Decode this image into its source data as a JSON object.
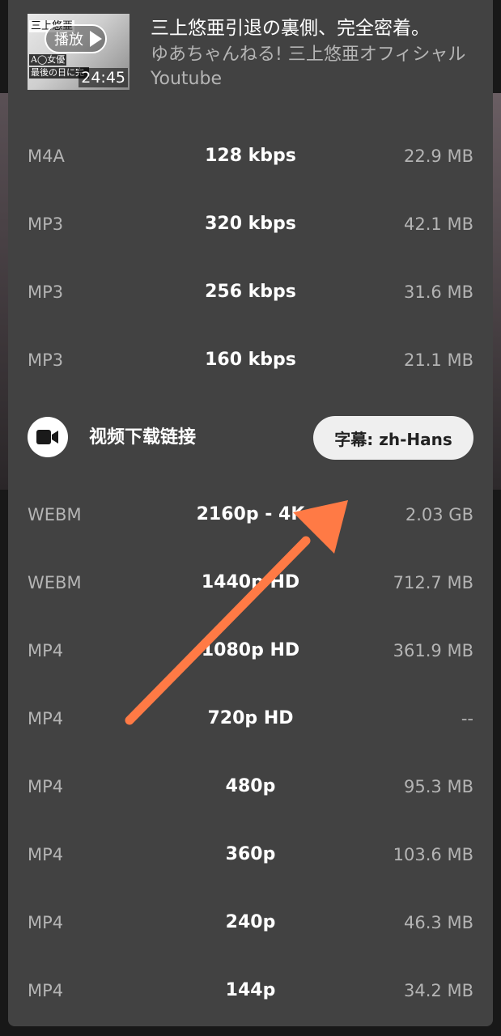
{
  "video": {
    "title": "三上悠亜引退の裏側、完全密着。",
    "channel": "ゆあちゃんねる! 三上悠亜オフィシャルYoutube",
    "duration": "24:45",
    "play_label": "播放",
    "thumb_text_1": "三上悠亜",
    "thumb_text_2": "A◯女優",
    "thumb_text_3": "最後の日に完"
  },
  "audio_options": [
    {
      "format": "M4A",
      "quality": "128 kbps",
      "size": "22.9 MB"
    },
    {
      "format": "MP3",
      "quality": "320 kbps",
      "size": "42.1 MB"
    },
    {
      "format": "MP3",
      "quality": "256 kbps",
      "size": "31.6 MB"
    },
    {
      "format": "MP3",
      "quality": "160 kbps",
      "size": "21.1 MB"
    }
  ],
  "video_section": {
    "icon": "video-camera-icon",
    "title": "视频下载链接",
    "subtitles_button": "字幕: zh-Hans"
  },
  "video_options": [
    {
      "format": "WEBM",
      "quality": "2160p - 4K",
      "size": "2.03 GB"
    },
    {
      "format": "WEBM",
      "quality": "1440p HD",
      "size": "712.7 MB"
    },
    {
      "format": "MP4",
      "quality": "1080p HD",
      "size": "361.9 MB"
    },
    {
      "format": "MP4",
      "quality": "720p HD",
      "size": "--"
    },
    {
      "format": "MP4",
      "quality": "480p",
      "size": "95.3 MB"
    },
    {
      "format": "MP4",
      "quality": "360p",
      "size": "103.6 MB"
    },
    {
      "format": "MP4",
      "quality": "240p",
      "size": "46.3 MB"
    },
    {
      "format": "MP4",
      "quality": "144p",
      "size": "34.2 MB"
    }
  ],
  "annotation": {
    "arrow_color": "#ff7a45"
  }
}
